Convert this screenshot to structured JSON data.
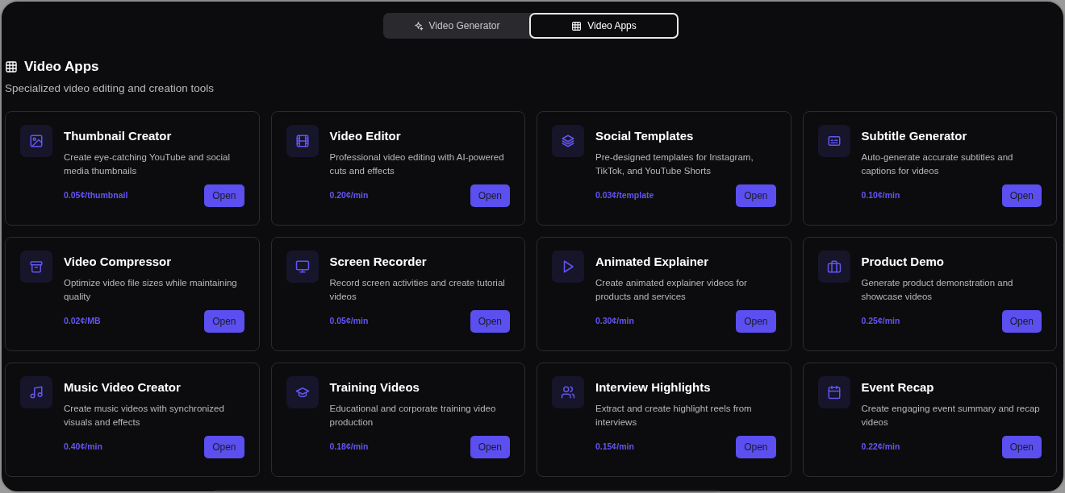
{
  "tabs": [
    {
      "label": "Video Generator",
      "selected": false
    },
    {
      "label": "Video Apps",
      "selected": true
    }
  ],
  "section": {
    "title": "Video Apps",
    "subtitle": "Specialized video editing and creation tools"
  },
  "apps": [
    {
      "title": "Thumbnail Creator",
      "description": "Create eye-catching YouTube and social media thumbnails",
      "price": "0.05¢/thumbnail",
      "button": "Open"
    },
    {
      "title": "Video Editor",
      "description": "Professional video editing with AI-powered cuts and effects",
      "price": "0.20¢/min",
      "button": "Open"
    },
    {
      "title": "Social Templates",
      "description": "Pre-designed templates for Instagram, TikTok, and YouTube Shorts",
      "price": "0.03¢/template",
      "button": "Open"
    },
    {
      "title": "Subtitle Generator",
      "description": "Auto-generate accurate subtitles and captions for videos",
      "price": "0.10¢/min",
      "button": "Open"
    },
    {
      "title": "Video Compressor",
      "description": "Optimize video file sizes while maintaining quality",
      "price": "0.02¢/MB",
      "button": "Open"
    },
    {
      "title": "Screen Recorder",
      "description": "Record screen activities and create tutorial videos",
      "price": "0.05¢/min",
      "button": "Open"
    },
    {
      "title": "Animated Explainer",
      "description": "Create animated explainer videos for products and services",
      "price": "0.30¢/min",
      "button": "Open"
    },
    {
      "title": "Product Demo",
      "description": "Generate product demonstration and showcase videos",
      "price": "0.25¢/min",
      "button": "Open"
    },
    {
      "title": "Music Video Creator",
      "description": "Create music videos with synchronized visuals and effects",
      "price": "0.40¢/min",
      "button": "Open"
    },
    {
      "title": "Training Videos",
      "description": "Educational and corporate training video production",
      "price": "0.18¢/min",
      "button": "Open"
    },
    {
      "title": "Interview Highlights",
      "description": "Extract and create highlight reels from interviews",
      "price": "0.15¢/min",
      "button": "Open"
    },
    {
      "title": "Event Recap",
      "description": "Create engaging event summary and recap videos",
      "price": "0.22¢/min",
      "button": "Open"
    }
  ]
}
